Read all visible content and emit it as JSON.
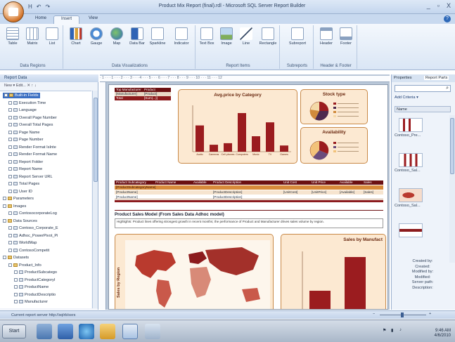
{
  "app": {
    "window_title": "Product Mix Report (final).rdl - Microsoft SQL Server Report Builder",
    "qat": [
      "H",
      "↶",
      "↷"
    ],
    "window_controls": [
      "_",
      "▫",
      "X"
    ]
  },
  "ribbon": {
    "tabs": [
      {
        "label": "Home",
        "active": false
      },
      {
        "label": "Insert",
        "active": true
      },
      {
        "label": "View",
        "active": false
      }
    ],
    "groups": [
      {
        "label": "Data Regions",
        "buttons": [
          "Table",
          "Matrix",
          "List"
        ]
      },
      {
        "label": "Data Visualizations",
        "buttons": [
          "Chart",
          "Gauge",
          "Map",
          "Data Bar",
          "Sparkline",
          "Indicator"
        ]
      },
      {
        "label": "Report Items",
        "buttons": [
          "Text Box",
          "Image",
          "Line",
          "Rectangle"
        ]
      },
      {
        "label": "Subreports",
        "buttons": [
          "Subreport"
        ]
      },
      {
        "label": "Header & Footer",
        "buttons": [
          "Header",
          "Footer"
        ]
      }
    ]
  },
  "report_data": {
    "title": "Report Data",
    "toolbar": "New ▾  Edit...   ✕   ↑   ↓",
    "tree": [
      {
        "label": "Built-in Fields",
        "level": 0,
        "kind": "folder",
        "selected": true
      },
      {
        "label": "Execution Time",
        "level": 1,
        "kind": "field"
      },
      {
        "label": "Language",
        "level": 1,
        "kind": "field"
      },
      {
        "label": "Overall Page Number",
        "level": 1,
        "kind": "field"
      },
      {
        "label": "Overall Total Pages",
        "level": 1,
        "kind": "field"
      },
      {
        "label": "Page Name",
        "level": 1,
        "kind": "field"
      },
      {
        "label": "Page Number",
        "level": 1,
        "kind": "field"
      },
      {
        "label": "Render Format IsInte",
        "level": 1,
        "kind": "field"
      },
      {
        "label": "Render Format Name",
        "level": 1,
        "kind": "field"
      },
      {
        "label": "Report Folder",
        "level": 1,
        "kind": "field"
      },
      {
        "label": "Report Name",
        "level": 1,
        "kind": "field"
      },
      {
        "label": "Report Server URL",
        "level": 1,
        "kind": "field"
      },
      {
        "label": "Total Pages",
        "level": 1,
        "kind": "field"
      },
      {
        "label": "User ID",
        "level": 1,
        "kind": "field"
      },
      {
        "label": "Parameters",
        "level": 0,
        "kind": "folder"
      },
      {
        "label": "Images",
        "level": 0,
        "kind": "folder"
      },
      {
        "label": "ContosocorporateLog",
        "level": 1,
        "kind": "field"
      },
      {
        "label": "Data Sources",
        "level": 0,
        "kind": "folder"
      },
      {
        "label": "Contoso_Corporate_E",
        "level": 1,
        "kind": "field"
      },
      {
        "label": "Adhoc_PowerPivot_Pi",
        "level": 1,
        "kind": "field"
      },
      {
        "label": "WorldMap",
        "level": 1,
        "kind": "field"
      },
      {
        "label": "ContosoCompetit",
        "level": 1,
        "kind": "field"
      },
      {
        "label": "Datasets",
        "level": 0,
        "kind": "folder"
      },
      {
        "label": "Product_Info",
        "level": 1,
        "kind": "folder"
      },
      {
        "label": "ProductSubcatego",
        "level": 2,
        "kind": "field"
      },
      {
        "label": "ProductCategoryI",
        "level": 2,
        "kind": "field"
      },
      {
        "label": "ProductName",
        "level": 2,
        "kind": "field"
      },
      {
        "label": "ProductDescriptio",
        "level": 2,
        "kind": "field"
      },
      {
        "label": "Manufacturer",
        "level": 2,
        "kind": "field"
      }
    ]
  },
  "ruler_labels": "· 1 · · · 1 · · · 2 · · · 3 · · · 4 · · · 5 · · · 6 · · · 7 · · · 8 · · · 9 · · · 10 · · · 11 · · · 12",
  "canvas": {
    "top_table": {
      "headers": [
        "Top Manufacturer",
        "Product"
      ],
      "rows": [
        [
          "[Manufacturer]",
          "[Product]"
        ],
        [
          "Total",
          "[Sum(...)]"
        ]
      ]
    },
    "avg_chart_title": "Avg.price by Category",
    "stock_type_title": "Stock type",
    "availability_title": "Availability",
    "detail_table": {
      "headers": [
        "Product Subcategory",
        "Product Name",
        "Available",
        "Product Description",
        "Unit Cost",
        "Unit Price",
        "Available",
        "Sales"
      ],
      "rows": [
        [
          "[ProductSubcategoryName]",
          "",
          "",
          "",
          "",
          "",
          "",
          ""
        ],
        [
          "[ProductName]",
          "",
          "",
          "[ProductDescription]",
          "[UnitCost]",
          "[UnitPrice]",
          "[Available]",
          "[Sales]"
        ],
        [
          "[ProductName]",
          "",
          "",
          "[ProductDescription]",
          "",
          "",
          "",
          ""
        ]
      ]
    },
    "section_title": "Product Sales Model (From Sales Data Adhoc model)",
    "section_desc": "Highlights: Product lines offering strongest growth in recent months; the performance of Product and Manufacturer drives sales volume by region.",
    "map_ylabel": "Sales by Region",
    "sales_chart_title": "Sales by Manufact"
  },
  "chart_data": [
    {
      "type": "bar",
      "title": "Avg.price by Category",
      "categories": [
        "Audio",
        "Cameras",
        "Cell phones",
        "Computers",
        "Music",
        "TV",
        "Games"
      ],
      "values": [
        170,
        45,
        55,
        250,
        100,
        190,
        40
      ],
      "ylim": [
        0,
        300
      ],
      "color": "#9b1c1f"
    },
    {
      "type": "bar",
      "title": "Sales by Manufact",
      "values": [
        40,
        100
      ],
      "color": "#9b1c1f"
    }
  ],
  "report_parts": {
    "tabs": [
      "Properties",
      "Report Parts"
    ],
    "criteria": "Add Criteria ▾",
    "name_header": "Name",
    "items": [
      "Contoso_Pre...",
      "Contoso_Sal...",
      "Contoso_Sal..."
    ],
    "info": [
      "Created by:",
      "Created:",
      "Modified by:",
      "Modified:",
      "Server path:",
      "Description:"
    ]
  },
  "status": {
    "text": "Current report server http://sqlrb/ssrs",
    "zoom_minus": "−",
    "zoom_plus": "+"
  },
  "taskbar": {
    "start": "Start",
    "clock_time": "9:46 AM",
    "clock_date": "4/6/2010"
  },
  "colors": {
    "accent": "#9b1c1f",
    "panel": "#fce9d2",
    "ribbon": "#dae6f5"
  }
}
